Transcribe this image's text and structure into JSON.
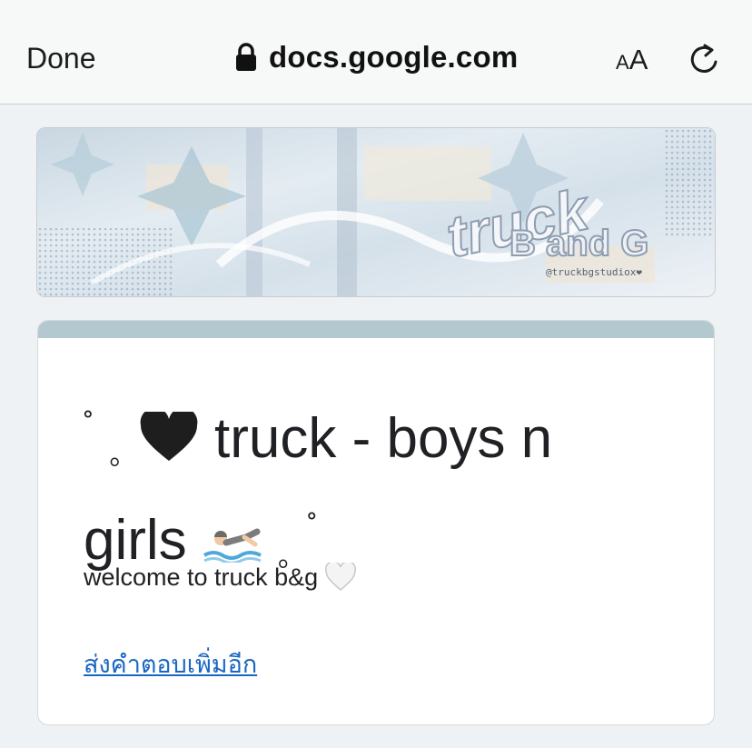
{
  "browser": {
    "done_label": "Done",
    "url": "docs.google.com",
    "text_size_small": "A",
    "text_size_large": "A"
  },
  "banner": {
    "logo_text": "truck",
    "logo_sub": "B and G",
    "handle": "@truckbgstudiox❤"
  },
  "form": {
    "title_part1": "truck - boys n",
    "title_part2": "girls",
    "deco_ring": "˚",
    "deco_dot": "｡",
    "description": "welcome to truck b&g",
    "link": "ส่งคำตอบเพิ่มอีก"
  },
  "colors": {
    "accent_bar": "#b3c9cf",
    "link": "#1a66c2"
  }
}
